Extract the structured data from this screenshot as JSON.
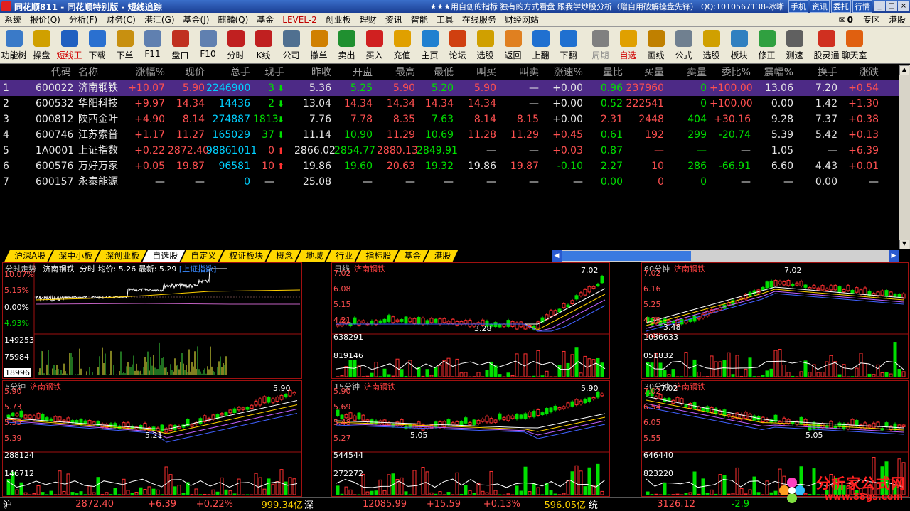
{
  "titlebar": {
    "title": "同花顺811 - 同花顺特别版 - 短线追踪",
    "promo": "★★★用自创的指标 独有的方式看盘 跟我学炒股分析（赠自用破解操盘先锋）",
    "qq": "QQ:1010567138-冰晰",
    "buttons": [
      "手机",
      "资讯",
      "委托",
      "行情"
    ]
  },
  "menubar": {
    "items": [
      "系统",
      "报价(Q)",
      "分析(F)",
      "财务(C)",
      "港汇(G)",
      "基金(J)",
      "麒麟(Q)",
      "基金",
      "LEVEL-2",
      "创业板",
      "理财",
      "资讯",
      "智能",
      "工具",
      "在线服务",
      "财经网站"
    ],
    "mail_count": "0",
    "right_items": [
      "专区",
      "港股"
    ]
  },
  "toolbar": {
    "items": [
      {
        "label": "功能树",
        "icon": "tree-icon",
        "color": "#3a7ac8"
      },
      {
        "label": "操盘",
        "icon": "trader-icon",
        "color": "#d0a000"
      },
      {
        "label": "短线王",
        "icon": "king-icon",
        "color": "#2060c0",
        "red": true
      },
      {
        "label": "下载",
        "icon": "globe-icon",
        "color": "#2a70d0"
      },
      {
        "label": "下单",
        "icon": "order-icon",
        "color": "#c89010"
      },
      {
        "label": "F11",
        "icon": "f11-icon",
        "color": "#6080b0"
      },
      {
        "label": "盘口",
        "icon": "handicap-icon",
        "color": "#c03020"
      },
      {
        "label": "F10",
        "icon": "f10-icon",
        "color": "#6080b0"
      },
      {
        "label": "分时",
        "icon": "minute-icon",
        "color": "#c02020"
      },
      {
        "label": "K线",
        "icon": "kline-icon",
        "color": "#c02020"
      },
      {
        "label": "公司",
        "icon": "company-icon",
        "color": "#507090"
      },
      {
        "label": "撤单",
        "icon": "cancel-order-icon",
        "color": "#d08000"
      },
      {
        "label": "卖出",
        "icon": "sell-icon",
        "color": "#209030"
      },
      {
        "label": "买入",
        "icon": "buy-icon",
        "color": "#d02020"
      },
      {
        "label": "充值",
        "icon": "recharge-icon",
        "color": "#e0a000"
      },
      {
        "label": "主页",
        "icon": "home-page-icon",
        "color": "#2080d0"
      },
      {
        "label": "论坛",
        "icon": "forum-icon",
        "color": "#d04010"
      },
      {
        "label": "选股",
        "icon": "filter-icon",
        "color": "#d0a000"
      },
      {
        "label": "返回",
        "icon": "back-icon",
        "color": "#e08020"
      },
      {
        "label": "上翻",
        "icon": "up-icon",
        "color": "#2070d0"
      },
      {
        "label": "下翻",
        "icon": "down-icon",
        "color": "#2070d0"
      },
      {
        "label": "周期",
        "icon": "period-icon",
        "color": "#808080",
        "dim": true
      },
      {
        "label": "自选",
        "icon": "star-icon",
        "color": "#e0a000",
        "red": true
      },
      {
        "label": "画线",
        "icon": "pen-icon",
        "color": "#c08000"
      },
      {
        "label": "公式",
        "icon": "formula-icon",
        "color": "#708090"
      },
      {
        "label": "选股",
        "icon": "select-stock-icon",
        "color": "#d0a000"
      },
      {
        "label": "板块",
        "icon": "sector-icon",
        "color": "#3080c0"
      },
      {
        "label": "修正",
        "icon": "fix-icon",
        "color": "#30a040"
      },
      {
        "label": "测速",
        "icon": "speed-icon",
        "color": "#606060"
      },
      {
        "label": "股灵通",
        "icon": "notice-icon",
        "color": "#d03020"
      },
      {
        "label": "聊天室",
        "icon": "chat-icon",
        "color": "#e06010"
      }
    ]
  },
  "table": {
    "headers": [
      "代码",
      "名称",
      "涨幅%",
      "现价",
      "总手",
      "现手",
      "昨收",
      "开盘",
      "最高",
      "最低",
      "叫买",
      "叫卖",
      "涨速%",
      "量比",
      "买量",
      "卖量",
      "委比%",
      "震幅%",
      "换手",
      "涨跌"
    ],
    "rows": [
      {
        "idx": "1",
        "code": "600022",
        "name": "济南钢铁",
        "chg": "+10.07",
        "price": "5.90",
        "vol": "2246900",
        "cur": "3",
        "dir": "down",
        "prev": "5.36",
        "open": "5.25",
        "high": "5.90",
        "low": "5.20",
        "bid": "5.90",
        "ask": "—",
        "speed": "+0.00",
        "qr": "0.96",
        "bvol": "237960",
        "svol": "0",
        "wb": "+100.00",
        "amp": "13.06",
        "turn": "7.20",
        "diff": "+0.54",
        "c": {
          "chg": "r",
          "price": "r",
          "open": "g",
          "high": "r",
          "low": "g",
          "bid": "r",
          "bvol": "r",
          "svol": "g",
          "wb": "r",
          "diff": "r"
        }
      },
      {
        "idx": "2",
        "code": "600532",
        "name": "华阳科技",
        "chg": "+9.97",
        "price": "14.34",
        "vol": "14436",
        "cur": "2",
        "dir": "down",
        "prev": "13.04",
        "open": "14.34",
        "high": "14.34",
        "low": "14.34",
        "bid": "14.34",
        "ask": "—",
        "speed": "+0.00",
        "qr": "0.52",
        "bvol": "222541",
        "svol": "0",
        "wb": "+100.00",
        "amp": "0.00",
        "turn": "1.42",
        "diff": "+1.30",
        "c": {
          "chg": "r",
          "price": "r",
          "open": "r",
          "high": "r",
          "low": "r",
          "bid": "r",
          "bvol": "r",
          "svol": "g",
          "wb": "r",
          "diff": "r"
        }
      },
      {
        "idx": "3",
        "code": "000812",
        "name": "陕西金叶",
        "chg": "+4.90",
        "price": "8.14",
        "vol": "274887",
        "cur": "1813",
        "dir": "down",
        "prev": "7.76",
        "open": "7.78",
        "high": "8.35",
        "low": "7.63",
        "bid": "8.14",
        "ask": "8.15",
        "speed": "+0.00",
        "qr": "2.31",
        "bvol": "2448",
        "svol": "404",
        "wb": "+30.16",
        "amp": "9.28",
        "turn": "7.37",
        "diff": "+0.38",
        "c": {
          "chg": "r",
          "price": "r",
          "open": "r",
          "high": "r",
          "low": "g",
          "bid": "r",
          "bvol": "r",
          "svol": "g",
          "wb": "r",
          "diff": "r"
        }
      },
      {
        "idx": "4",
        "code": "600746",
        "name": "江苏索普",
        "chg": "+1.17",
        "price": "11.27",
        "vol": "165029",
        "cur": "37",
        "dir": "down",
        "prev": "11.14",
        "open": "10.90",
        "high": "11.29",
        "low": "10.69",
        "bid": "11.28",
        "ask": "11.29",
        "speed": "+0.45",
        "qr": "0.61",
        "bvol": "192",
        "svol": "299",
        "wb": "-20.74",
        "amp": "5.39",
        "turn": "5.42",
        "diff": "+0.13",
        "c": {
          "chg": "r",
          "price": "r",
          "open": "g",
          "high": "r",
          "low": "g",
          "bid": "r",
          "bvol": "r",
          "svol": "g",
          "wb": "g",
          "diff": "r"
        }
      },
      {
        "idx": "5",
        "code": "1A0001",
        "name": "上证指数",
        "chg": "+0.22",
        "price": "2872.40",
        "vol": "98861011",
        "cur": "0",
        "dir": "up",
        "prev": "2866.02",
        "open": "2854.77",
        "high": "2880.13",
        "low": "2849.91",
        "bid": "—",
        "ask": "—",
        "speed": "+0.03",
        "qr": "0.87",
        "bvol": "—",
        "svol": "—",
        "wb": "—",
        "amp": "1.05",
        "turn": "—",
        "diff": "+6.39",
        "c": {
          "chg": "r",
          "price": "r",
          "open": "g",
          "high": "r",
          "low": "g",
          "bid": "w",
          "bvol": "r",
          "svol": "g",
          "wb": "w",
          "diff": "r"
        }
      },
      {
        "idx": "6",
        "code": "600576",
        "name": "万好万家",
        "chg": "+0.05",
        "price": "19.87",
        "vol": "96581",
        "cur": "10",
        "dir": "up",
        "prev": "19.86",
        "open": "19.60",
        "high": "20.63",
        "low": "19.32",
        "bid": "19.86",
        "ask": "19.87",
        "speed": "-0.10",
        "qr": "2.27",
        "bvol": "10",
        "svol": "286",
        "wb": "-66.91",
        "amp": "6.60",
        "turn": "4.43",
        "diff": "+0.01",
        "c": {
          "chg": "r",
          "price": "r",
          "open": "g",
          "high": "r",
          "low": "g",
          "bid": "w",
          "bvol": "r",
          "svol": "g",
          "wb": "g",
          "diff": "r"
        }
      },
      {
        "idx": "7",
        "code": "600157",
        "name": "永泰能源",
        "chg": "—",
        "price": "—",
        "vol": "0",
        "cur": "—",
        "dir": "",
        "prev": "25.08",
        "open": "—",
        "high": "—",
        "low": "—",
        "bid": "—",
        "ask": "—",
        "speed": "—",
        "qr": "0.00",
        "bvol": "0",
        "svol": "0",
        "wb": "—",
        "amp": "—",
        "turn": "0.00",
        "diff": "—",
        "c": {
          "chg": "w",
          "price": "w",
          "open": "w",
          "high": "w",
          "low": "w",
          "bid": "w",
          "bvol": "r",
          "svol": "g",
          "wb": "w",
          "diff": "w"
        }
      }
    ]
  },
  "tabs": [
    "沪深A股",
    "深中小板",
    "深创业板",
    "自选股",
    "自定义",
    "权证板块",
    "概念",
    "地域",
    "行业",
    "指标股",
    "基金",
    "港股"
  ],
  "active_tab": "自选股",
  "intraday": {
    "title": "分时走势",
    "stock": "济南钢铁",
    "info": "分时 均价: 5.26 最新: 5.29",
    "index_link": "[上证指数]",
    "y_labels": [
      "10.07%",
      "5.15%",
      "0.00%",
      "4.93%"
    ],
    "vol_labels": [
      "149253",
      "75984",
      "18996"
    ]
  },
  "kpanes": [
    {
      "period": "日线",
      "stock": "济南钢铁",
      "labels": [
        "7.02",
        "6.08",
        "5.15",
        "4.21"
      ],
      "vol": [
        "638291",
        "819146"
      ],
      "hi": "7.02",
      "lo": "3.28"
    },
    {
      "period": "60分钟",
      "stock": "济南钢铁",
      "labels": [
        "7.02",
        "6.16",
        "5.25",
        "4.39",
        "3.48"
      ],
      "vol": [
        "1036633",
        "051832"
      ],
      "hi": "7.02",
      "lo": "3.48"
    },
    {
      "period": "5分钟",
      "stock": "济南钢铁",
      "labels": [
        "5.90",
        "5.73",
        "5.55",
        "5.39"
      ],
      "vol": [
        "288124",
        "146712"
      ],
      "hi": "5.90",
      "lo": "5.21"
    },
    {
      "period": "15分钟",
      "stock": "济南钢铁",
      "labels": [
        "5.90",
        "5.69",
        "5.48",
        "5.27"
      ],
      "vol": [
        "544544",
        "272272"
      ],
      "hi": "5.90",
      "lo": "5.05"
    },
    {
      "period": "30分钟",
      "stock": "济南钢铁",
      "labels": [
        "7.02",
        "6.54",
        "6.05",
        "5.55"
      ],
      "vol": [
        "646440",
        "823220"
      ],
      "hi": "7.02",
      "lo": "5.05"
    }
  ],
  "status": {
    "sh_label": "沪",
    "sh_price": "2872.40",
    "sh_chg": "+6.39",
    "sh_pct": "+0.22%",
    "sh_amt": "999.34亿",
    "sz_label": "深",
    "sz_price": "12085.99",
    "sz_chg": "+15.59",
    "sz_pct": "+0.13%",
    "sz_amt": "596.05亿",
    "t_label": "统",
    "t_price": "3126.12",
    "t_chg": "-2.9"
  },
  "brand": {
    "name": "分析家公式网",
    "url": "www.88gs.com"
  }
}
